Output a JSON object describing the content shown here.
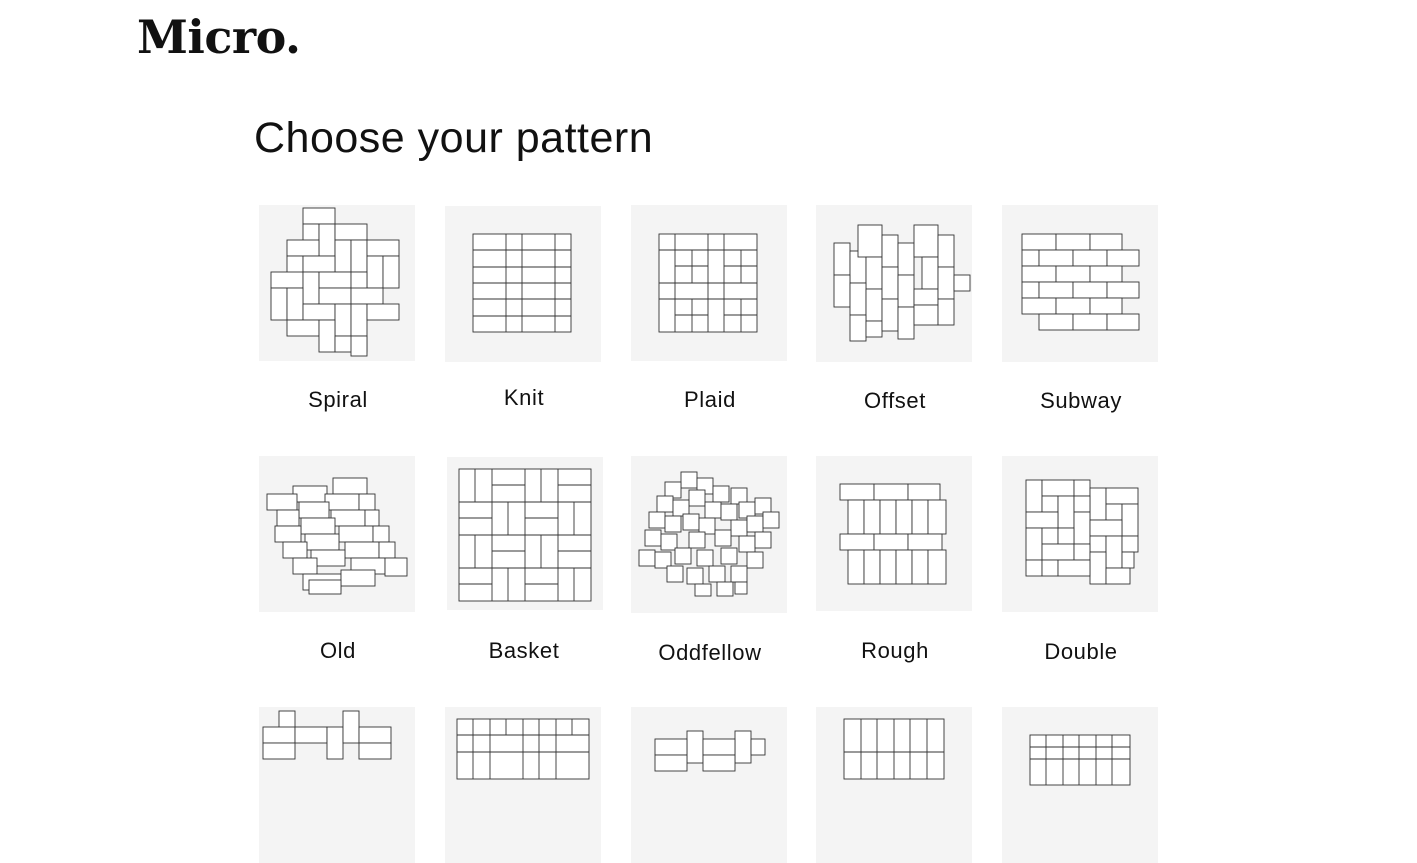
{
  "brand": {
    "logo_text": "Micro."
  },
  "page": {
    "title": "Choose your pattern"
  },
  "patterns": [
    {
      "name": "Spiral",
      "icon": "spiral-pattern-thumbnail"
    },
    {
      "name": "Knit",
      "icon": "knit-pattern-thumbnail"
    },
    {
      "name": "Plaid",
      "icon": "plaid-pattern-thumbnail"
    },
    {
      "name": "Offset",
      "icon": "offset-pattern-thumbnail"
    },
    {
      "name": "Subway",
      "icon": "subway-pattern-thumbnail"
    },
    {
      "name": "Old",
      "icon": "old-pattern-thumbnail"
    },
    {
      "name": "Basket",
      "icon": "basket-pattern-thumbnail"
    },
    {
      "name": "Oddfellow",
      "icon": "oddfellow-pattern-thumbnail"
    },
    {
      "name": "Rough",
      "icon": "rough-pattern-thumbnail"
    },
    {
      "name": "Double",
      "icon": "double-pattern-thumbnail"
    },
    {
      "name": "",
      "icon": "pattern-thumbnail"
    },
    {
      "name": "",
      "icon": "pattern-thumbnail"
    },
    {
      "name": "",
      "icon": "pattern-thumbnail"
    },
    {
      "name": "",
      "icon": "pattern-thumbnail"
    },
    {
      "name": "",
      "icon": "pattern-thumbnail"
    }
  ]
}
